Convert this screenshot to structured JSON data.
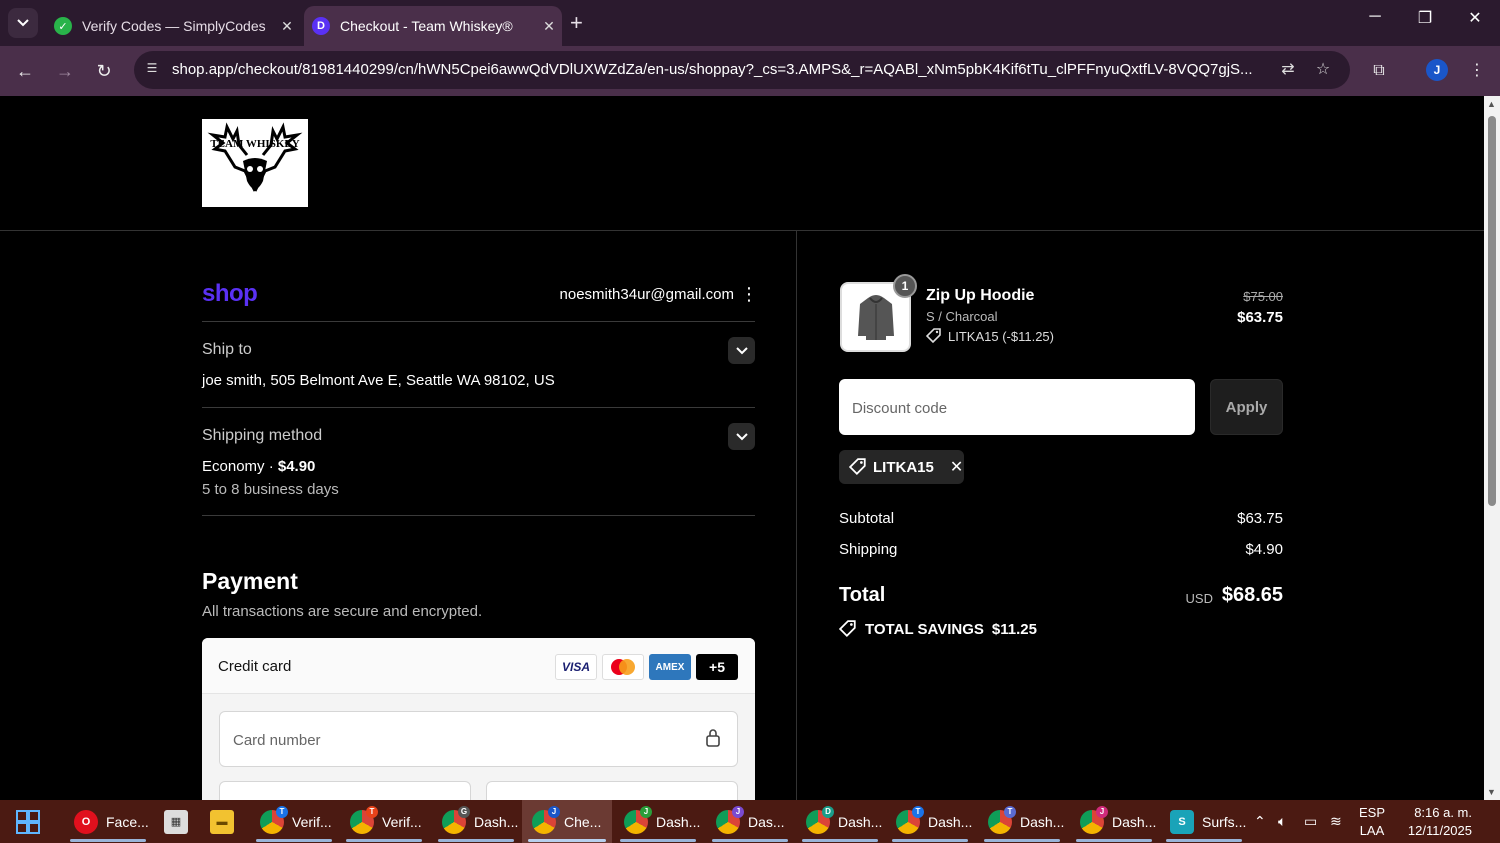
{
  "browser": {
    "tabs": [
      {
        "title": "Verify Codes — SimplyCodes",
        "active": false
      },
      {
        "title": "Checkout - Team Whiskey®",
        "active": true
      }
    ],
    "url": "shop.app/checkout/81981440299/cn/hWN5Cpei6awwQdVDlUXWZdZa/en-us/shoppay?_cs=3.AMPS&_r=AQABl_xNm5pbK4Kif6tTu_clPFFnyuQxtfLV-8VQQ7gjS...",
    "profile_initial": "J"
  },
  "store": {
    "logo_text": "TEAM WHISKEY"
  },
  "account": {
    "shop_brand": "shop",
    "email": "noesmith34ur@gmail.com"
  },
  "ship_to": {
    "label": "Ship to",
    "value": "joe smith, 505 Belmont Ave E, Seattle WA 98102, US"
  },
  "shipping_method": {
    "label": "Shipping method",
    "name": "Economy · ",
    "price": "$4.90",
    "eta": "5 to 8 business days"
  },
  "payment": {
    "title": "Payment",
    "subtitle": "All transactions are secure and encrypted.",
    "method_label": "Credit card",
    "brands": [
      "VISA",
      "MC",
      "AMEX",
      "+5"
    ],
    "card_number_placeholder": "Card number"
  },
  "order": {
    "item": {
      "quantity": "1",
      "name": "Zip Up Hoodie",
      "variant": "S / Charcoal",
      "discount": "LITKA15 (-$11.25)",
      "price_original": "$75.00",
      "price_final": "$63.75"
    },
    "discount_placeholder": "Discount code",
    "apply_label": "Apply",
    "applied_code": "LITKA15",
    "subtotal_label": "Subtotal",
    "subtotal": "$63.75",
    "shipping_label": "Shipping",
    "shipping": "$4.90",
    "total_label": "Total",
    "currency": "USD",
    "total": "$68.65",
    "savings_label": "TOTAL SAVINGS",
    "savings": "$11.25"
  },
  "taskbar": {
    "items": [
      {
        "label": "Face...",
        "icon": "opera-icon"
      },
      {
        "label": "",
        "icon": "calculator-icon"
      },
      {
        "label": "",
        "icon": "file-explorer-icon"
      },
      {
        "label": "Verif...",
        "icon": "chrome-icon"
      },
      {
        "label": "Verif...",
        "icon": "chrome-icon"
      },
      {
        "label": "Dash...",
        "icon": "chrome-icon"
      },
      {
        "label": "Che...",
        "icon": "chrome-icon"
      },
      {
        "label": "Dash...",
        "icon": "chrome-icon"
      },
      {
        "label": "Das...",
        "icon": "chrome-icon"
      },
      {
        "label": "Dash...",
        "icon": "chrome-icon"
      },
      {
        "label": "Dash...",
        "icon": "chrome-icon"
      },
      {
        "label": "Dash...",
        "icon": "chrome-icon"
      },
      {
        "label": "Dash...",
        "icon": "chrome-icon"
      },
      {
        "label": "Surfs...",
        "icon": "surfshark-icon"
      }
    ],
    "lang_top": "ESP",
    "lang_bottom": "LAA",
    "time": "8:16 a. m.",
    "date": "12/11/2025"
  },
  "colors": {
    "shop_purple": "#5a31f4",
    "tabbar": "#2b1a2e",
    "toolbar": "#4a2f4a",
    "taskbar": "#4b1a12"
  }
}
